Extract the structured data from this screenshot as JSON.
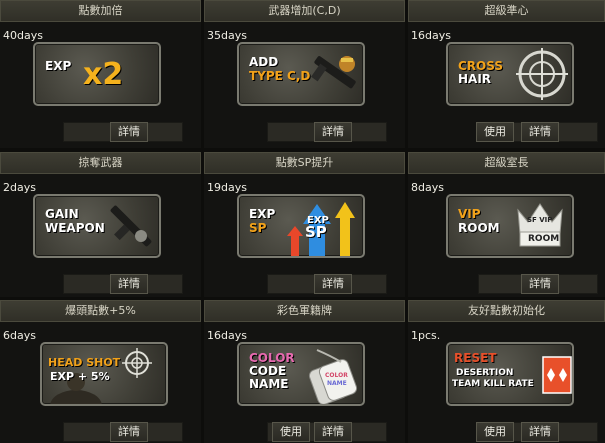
{
  "cards": [
    {
      "title": "點數加倍",
      "days": "40days",
      "tile": [
        "EXP",
        "x2"
      ],
      "detail": "詳情"
    },
    {
      "title": "武器增加(C,D)",
      "days": "35days",
      "tile": [
        "ADD",
        "TYPE C,D"
      ],
      "detail": "詳情"
    },
    {
      "title": "超級準心",
      "days": "16days",
      "tile": [
        "CROSS",
        "HAIR"
      ],
      "use": "使用",
      "detail": "詳情"
    },
    {
      "title": "掠奪武器",
      "days": "2days",
      "tile": [
        "GAIN",
        "WEAPON"
      ],
      "detail": "詳情"
    },
    {
      "title": "點數SP提升",
      "days": "19days",
      "tile": [
        "EXP",
        "SP"
      ],
      "badge": [
        "EXP",
        "SP"
      ],
      "detail": "詳情"
    },
    {
      "title": "超級室長",
      "days": "8days",
      "tile": [
        "VIP",
        "ROOM"
      ],
      "badge": [
        "SF VIP",
        "ROOM"
      ],
      "detail": "詳情"
    },
    {
      "title": "爆頭點數+5%",
      "days": "6days",
      "tile": [
        "HEAD SHOT",
        "EXP + 5%"
      ],
      "detail": "詳情"
    },
    {
      "title": "彩色軍籍牌",
      "days": "16days",
      "tile": [
        "COLOR",
        "CODE",
        "NAME"
      ],
      "badge": [
        "COLOR",
        "NAME"
      ],
      "use": "使用",
      "detail": "詳情"
    },
    {
      "title": "友好點數初始化",
      "days": "1pcs.",
      "tile": [
        "RESET",
        "DESERTION",
        "TEAM KILL RATE"
      ],
      "use": "使用",
      "detail": "詳情"
    }
  ],
  "colors": {
    "accent_orange": "#f2a21a",
    "tile_text": "#ffffff",
    "header_bg": "#3a3930"
  },
  "icons": [
    "gun-icon",
    "crosshair-icon",
    "arrows-icon",
    "crown-icon",
    "soldier-icon",
    "dogtag-icon",
    "diamond-icon"
  ]
}
